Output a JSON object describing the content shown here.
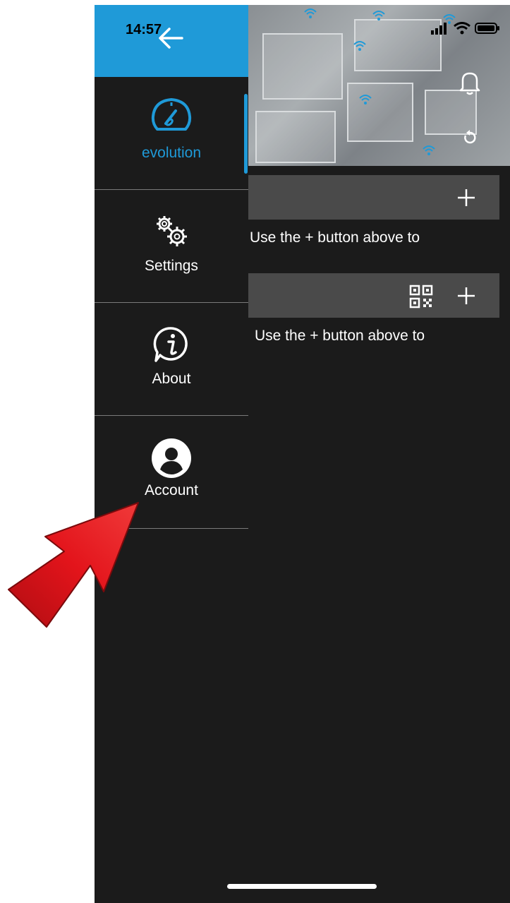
{
  "status_bar": {
    "time": "14:57"
  },
  "drawer": {
    "items": [
      {
        "label": "evolution",
        "icon": "speedometer-icon",
        "active": true
      },
      {
        "label": "Settings",
        "icon": "gears-icon"
      },
      {
        "label": "About",
        "icon": "info-bubble-icon"
      },
      {
        "label": "Account",
        "icon": "account-icon"
      }
    ]
  },
  "main": {
    "hint1": "Use the + button above to",
    "hint2": "Use the + button above to"
  },
  "colors": {
    "accent": "#1f9ad8",
    "background": "#1b1b1b",
    "bar": "#4a4a4a",
    "arrow": "#e3141b"
  }
}
